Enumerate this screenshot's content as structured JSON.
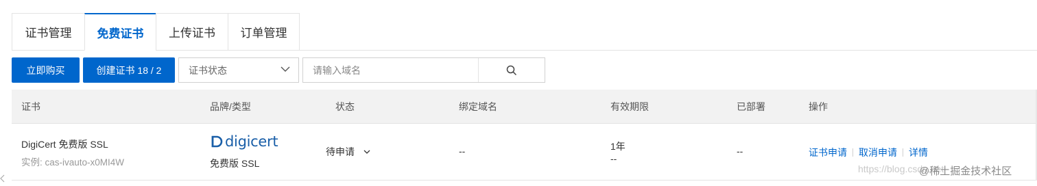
{
  "tabs": [
    {
      "label": "证书管理",
      "active": false
    },
    {
      "label": "免费证书",
      "active": true
    },
    {
      "label": "上传证书",
      "active": false
    },
    {
      "label": "订单管理",
      "active": false
    }
  ],
  "toolbar": {
    "buy_label": "立即购买",
    "create_label": "创建证书 18 / 2",
    "status_select": "证书状态",
    "search_placeholder": "请输入域名"
  },
  "table": {
    "headers": [
      "证书",
      "品牌/类型",
      "状态",
      "绑定域名",
      "有效期限",
      "已部署",
      "操作"
    ],
    "rows": [
      {
        "cert_name": "DigiCert 免费版 SSL",
        "instance": "实例: cas-ivauto-x0MI4W",
        "brand_logo": "digicert",
        "brand_type": "免费版 SSL",
        "status": "待申请",
        "domain": "--",
        "validity": "1年",
        "validity_sub": "--",
        "deployed": "--",
        "actions": [
          "证书申请",
          "取消申请",
          "详情"
        ]
      }
    ]
  },
  "watermark": {
    "url": "https://blog.csdn.net",
    "site": "@稀土掘金技术社区"
  },
  "colors": {
    "primary": "#0066cc",
    "header_bg": "#f2f2f2",
    "border": "#e3e3e3"
  },
  "icons": [
    "search-icon",
    "chevron-down-icon",
    "digicert-logo"
  ]
}
